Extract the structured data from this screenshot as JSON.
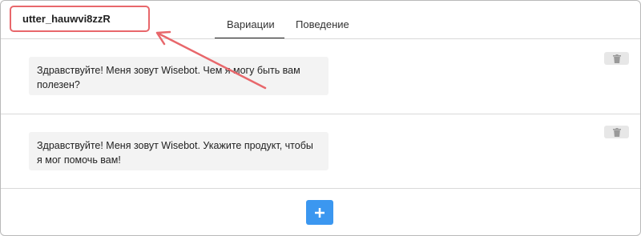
{
  "utterance": {
    "name": "utter_hauwvi8zzR"
  },
  "tabs": [
    {
      "label": "Вариации",
      "active": true
    },
    {
      "label": "Поведение",
      "active": false
    }
  ],
  "variations": [
    {
      "text": "Здравствуйте! Меня зовут Wisebot. Чем я могу быть вам полезен?"
    },
    {
      "text": "Здравствуйте! Меня зовут Wisebot. Укажите продукт, чтобы я мог помочь вам!"
    }
  ],
  "icons": {
    "delete": "trash-icon",
    "add": "plus-icon",
    "annotation": "arrow-icon"
  },
  "colors": {
    "highlight": "#e8676b",
    "accent": "#3b97f0"
  }
}
